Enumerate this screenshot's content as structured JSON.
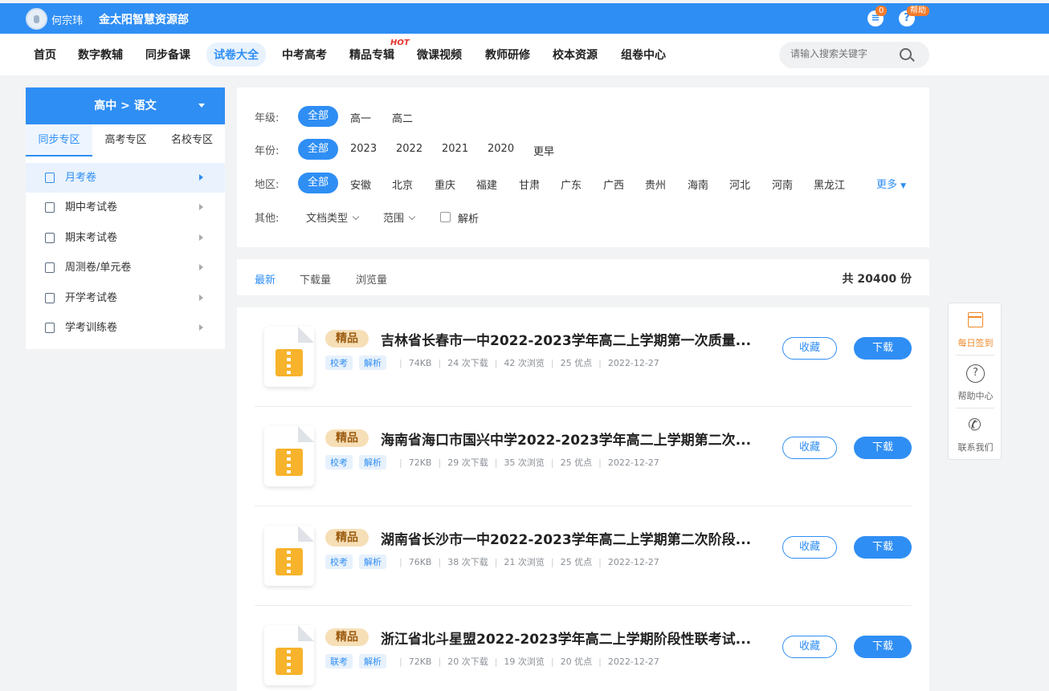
{
  "topbar": {
    "username": "何宗玮",
    "org": "金太阳智慧资源部",
    "msg_count": "0",
    "help_badge": "帮助"
  },
  "nav": {
    "items": [
      "首页",
      "数字教辅",
      "同步备课",
      "试卷大全",
      "中考高考",
      "精品专辑",
      "微课视频",
      "教师研修",
      "校本资源",
      "组卷中心"
    ],
    "active": "试卷大全",
    "hot_label": "HOT",
    "search_placeholder": "请输入搜索关键字"
  },
  "sidebar": {
    "header": "高中 > 语文",
    "tabs": [
      "同步专区",
      "高考专区",
      "名校专区"
    ],
    "items": [
      "月考卷",
      "期中考试卷",
      "期末考试卷",
      "周测卷/单元卷",
      "开学考试卷",
      "学考训练卷"
    ]
  },
  "filters": {
    "grade_label": "年级:",
    "grade_opts": [
      "全部",
      "高一",
      "高二"
    ],
    "year_label": "年份:",
    "year_opts": [
      "全部",
      "2023",
      "2022",
      "2021",
      "2020",
      "更早"
    ],
    "region_label": "地区:",
    "region_opts": [
      "全部",
      "安徽",
      "北京",
      "重庆",
      "福建",
      "甘肃",
      "广东",
      "广西",
      "贵州",
      "海南",
      "河北",
      "河南",
      "黑龙江"
    ],
    "more": "更多",
    "other_label": "其他:",
    "doc_type": "文档类型",
    "scope": "范围",
    "analysis": "解析"
  },
  "sort": {
    "options": [
      "最新",
      "下载量",
      "浏览量"
    ],
    "total": "共 20400 份"
  },
  "list": [
    {
      "badge": "精品",
      "title": "吉林省长春市一中2022-2023学年高二上学期第一次质量...",
      "tag1": "校考",
      "tag2": "解析",
      "size": "74KB",
      "downloads": "24 次下载",
      "views": "42 次浏览",
      "points": "25 优点",
      "date": "2022-12-27",
      "fav": "收藏",
      "dl": "下载"
    },
    {
      "badge": "精品",
      "title": "海南省海口市国兴中学2022-2023学年高二上学期第二次...",
      "tag1": "校考",
      "tag2": "解析",
      "size": "72KB",
      "downloads": "29 次下载",
      "views": "35 次浏览",
      "points": "25 优点",
      "date": "2022-12-27",
      "fav": "收藏",
      "dl": "下载"
    },
    {
      "badge": "精品",
      "title": "湖南省长沙市一中2022-2023学年高二上学期第二次阶段...",
      "tag1": "校考",
      "tag2": "解析",
      "size": "76KB",
      "downloads": "38 次下载",
      "views": "21 次浏览",
      "points": "25 优点",
      "date": "2022-12-27",
      "fav": "收藏",
      "dl": "下载"
    },
    {
      "badge": "精品",
      "title": "浙江省北斗星盟2022-2023学年高二上学期阶段性联考试...",
      "tag1": "联考",
      "tag2": "解析",
      "size": "72KB",
      "downloads": "20 次下载",
      "views": "19 次浏览",
      "points": "20 优点",
      "date": "2022-12-27",
      "fav": "收藏",
      "dl": "下载"
    }
  ],
  "float": {
    "checkin": "每日签到",
    "help": "帮助中心",
    "contact": "联系我们"
  },
  "colors": {
    "primary": "#2f8ef4",
    "accent": "#f08a2e",
    "badge": "#f6dfb7"
  }
}
